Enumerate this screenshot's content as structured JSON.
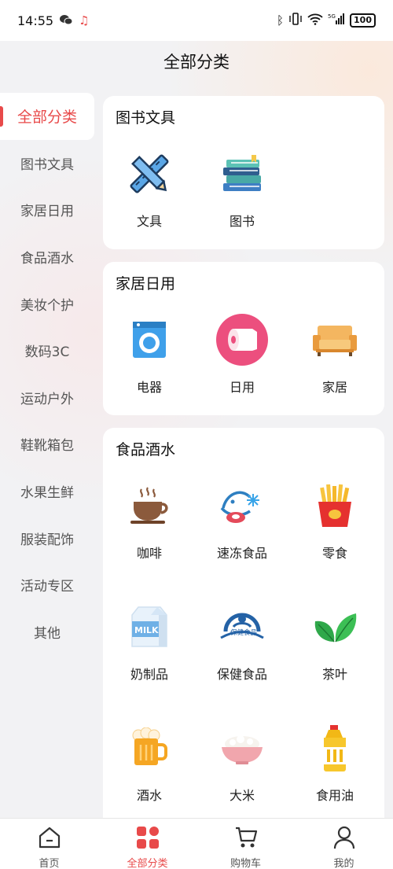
{
  "status_bar": {
    "time": "14:55",
    "battery": "100"
  },
  "header": {
    "title": "全部分类"
  },
  "sidebar": {
    "items": [
      {
        "label": "全部分类"
      },
      {
        "label": "图书文具"
      },
      {
        "label": "家居日用"
      },
      {
        "label": "食品酒水"
      },
      {
        "label": "美妆个护"
      },
      {
        "label": "数码3C"
      },
      {
        "label": "运动户外"
      },
      {
        "label": "鞋靴箱包"
      },
      {
        "label": "水果生鲜"
      },
      {
        "label": "服装配饰"
      },
      {
        "label": "活动专区"
      },
      {
        "label": "其他"
      }
    ],
    "active_index": 0
  },
  "sections": [
    {
      "title": "图书文具",
      "items": [
        {
          "label": "文具",
          "icon": "stationery-icon"
        },
        {
          "label": "图书",
          "icon": "books-icon"
        }
      ]
    },
    {
      "title": "家居日用",
      "items": [
        {
          "label": "电器",
          "icon": "washing-machine-icon"
        },
        {
          "label": "日用",
          "icon": "tissue-roll-icon"
        },
        {
          "label": "家居",
          "icon": "sofa-icon"
        }
      ]
    },
    {
      "title": "食品酒水",
      "items": [
        {
          "label": "咖啡",
          "icon": "coffee-cup-icon"
        },
        {
          "label": "速冻食品",
          "icon": "frozen-food-icon"
        },
        {
          "label": "零食",
          "icon": "fries-icon"
        },
        {
          "label": "奶制品",
          "icon": "milk-carton-icon"
        },
        {
          "label": "保健食品",
          "icon": "health-food-icon"
        },
        {
          "label": "茶叶",
          "icon": "tea-leaf-icon"
        },
        {
          "label": "酒水",
          "icon": "beer-mug-icon"
        },
        {
          "label": "大米",
          "icon": "rice-bowl-icon"
        },
        {
          "label": "食用油",
          "icon": "oil-bottle-icon"
        }
      ]
    }
  ],
  "icon_texts": {
    "milk": "MILK",
    "health": "保健食品"
  },
  "bottom_nav": {
    "items": [
      {
        "label": "首页",
        "icon": "home-icon"
      },
      {
        "label": "全部分类",
        "icon": "category-grid-icon"
      },
      {
        "label": "购物车",
        "icon": "cart-icon"
      },
      {
        "label": "我的",
        "icon": "user-icon"
      }
    ],
    "active_index": 1
  },
  "colors": {
    "accent": "#e84a4a",
    "background": "#f2f2f4"
  }
}
